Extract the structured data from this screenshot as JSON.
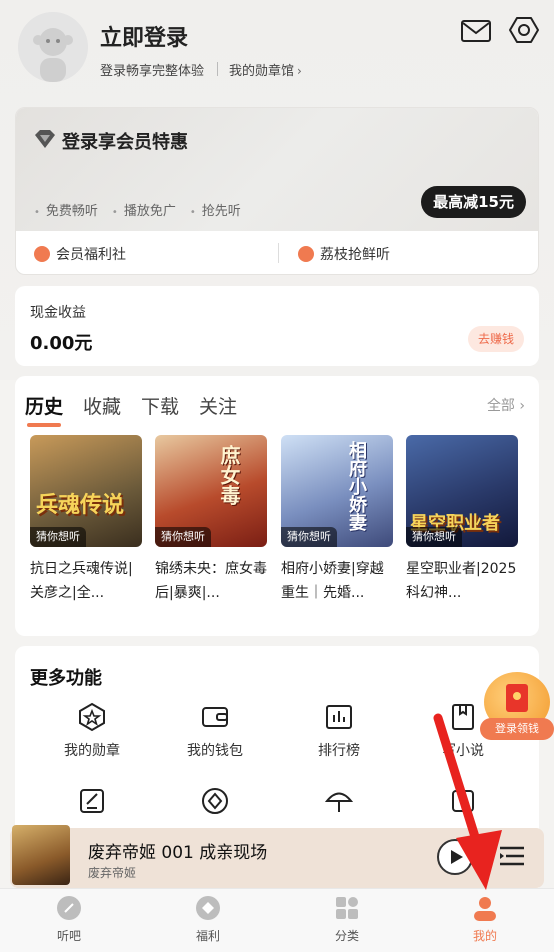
{
  "header": {
    "title": "立即登录",
    "subtitle": "登录畅享完整体验",
    "badge_link": "我的勋章馆",
    "chev": "›"
  },
  "vip": {
    "title": "登录享会员特惠",
    "perks": [
      "免费畅听",
      "播放免广",
      "抢先听"
    ],
    "max_discount": "最高减15元",
    "links": [
      "会员福利社",
      "荔枝抢鲜听"
    ]
  },
  "cash": {
    "label": "现金收益",
    "value": "0.00元",
    "button": "去赚钱"
  },
  "history": {
    "tabs": [
      "历史",
      "收藏",
      "下载",
      "关注"
    ],
    "all_link": "全部 ›",
    "books": [
      {
        "title": "抗日之兵魂传说|关彦之|全...",
        "tag": "猜你想听",
        "cover_text": "兵魂传说",
        "color": "#6b5a3a"
      },
      {
        "title": "锦绣未央：庶女毒后|暴爽|...",
        "tag": "猜你想听",
        "cover_text": "庶女毒",
        "color": "#b84b2c"
      },
      {
        "title": "相府小娇妻|穿越重生｜先婚...",
        "tag": "猜你想听",
        "cover_text": "相府小娇妻",
        "color": "#7a8fbf"
      },
      {
        "title": "星空职业者|2025科幻神...",
        "tag": "猜你想听",
        "cover_text": "星空职业者",
        "color": "#2a3a6a"
      }
    ]
  },
  "more": {
    "title": "更多功能",
    "items": [
      "我的勋章",
      "我的钱包",
      "排行榜",
      "写小说"
    ]
  },
  "float_bonus": {
    "label": "登录领钱"
  },
  "player": {
    "title": "废弃帝姬 001 成亲现场",
    "subtitle": "废弃帝姬"
  },
  "nav": {
    "items": [
      "听吧",
      "福利",
      "分类",
      "我的"
    ],
    "active": "我的"
  },
  "colors": {
    "accent": "#f07a50",
    "annotation": "#e8231f"
  }
}
